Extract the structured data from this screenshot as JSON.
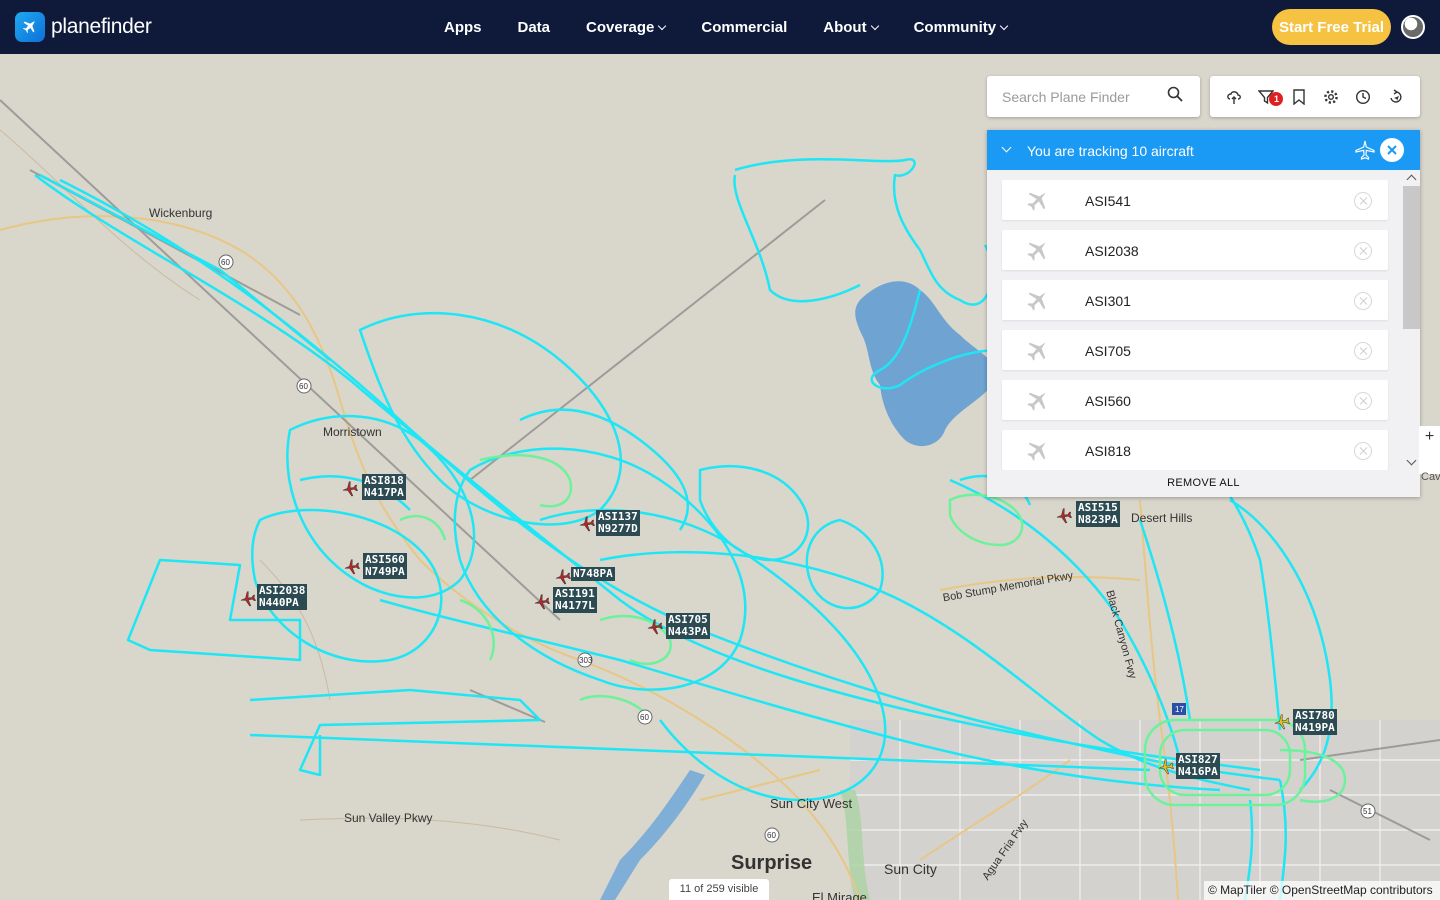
{
  "app": {
    "brand": "planefinder"
  },
  "nav": {
    "items": [
      {
        "label": "Apps",
        "dropdown": false
      },
      {
        "label": "Data",
        "dropdown": false
      },
      {
        "label": "Coverage",
        "dropdown": true
      },
      {
        "label": "Commercial",
        "dropdown": false
      },
      {
        "label": "About",
        "dropdown": true
      },
      {
        "label": "Community",
        "dropdown": true
      }
    ],
    "trial_button": "Start Free Trial"
  },
  "search": {
    "placeholder": "Search Plane Finder"
  },
  "toolbar": {
    "icons": [
      "weather-icon",
      "filter-icon",
      "bookmark-icon",
      "settings-icon",
      "history-icon",
      "playback-icon"
    ],
    "filter_badge": "1"
  },
  "tracking": {
    "title": "You are tracking 10 aircraft",
    "aircraft": [
      "ASI541",
      "ASI2038",
      "ASI301",
      "ASI705",
      "ASI560",
      "ASI818"
    ],
    "remove_all": "REMOVE ALL"
  },
  "map": {
    "zoom_in": "+",
    "visible_count": "11 of 259 visible",
    "attribution": "© MapTiler © OpenStreetMap contributors",
    "places": [
      "Wickenburg",
      "Morristown",
      "Desert Hills",
      "Surprise",
      "Sun City",
      "Sun City West",
      "Sun Valley Pkwy",
      "Bob Stump Memorial Pkwy",
      "Black Canyon Fwy",
      "Agua Fria Fwy",
      "El Mirage",
      "Cav"
    ],
    "flights": [
      {
        "callsign": "ASI818",
        "reg": "N417PA",
        "color": "#b02a2a"
      },
      {
        "callsign": "ASI137",
        "reg": "N9277D",
        "color": "#b02a2a"
      },
      {
        "callsign": "ASI560",
        "reg": "N749PA",
        "color": "#b02a2a"
      },
      {
        "callsign": "",
        "reg": "N748PA",
        "color": "#b02a2a"
      },
      {
        "callsign": "ASI2038",
        "reg": "N440PA",
        "color": "#b02a2a"
      },
      {
        "callsign": "ASI191",
        "reg": "N4177L",
        "color": "#b02a2a"
      },
      {
        "callsign": "ASI705",
        "reg": "N443PA",
        "color": "#b02a2a"
      },
      {
        "callsign": "ASI515",
        "reg": "N823PA",
        "color": "#b02a2a"
      },
      {
        "callsign": "ASI780",
        "reg": "N419PA",
        "color": "#e8c21a"
      },
      {
        "callsign": "ASI827",
        "reg": "N416PA",
        "color": "#e8c21a"
      }
    ]
  },
  "colors": {
    "nav_bg": "#0f1a3b",
    "accent": "#1a9af4",
    "trial": "#f5c242",
    "track": "#1ee6f5",
    "track_alt": "#6cf29a",
    "water": "#6ea3d2"
  }
}
